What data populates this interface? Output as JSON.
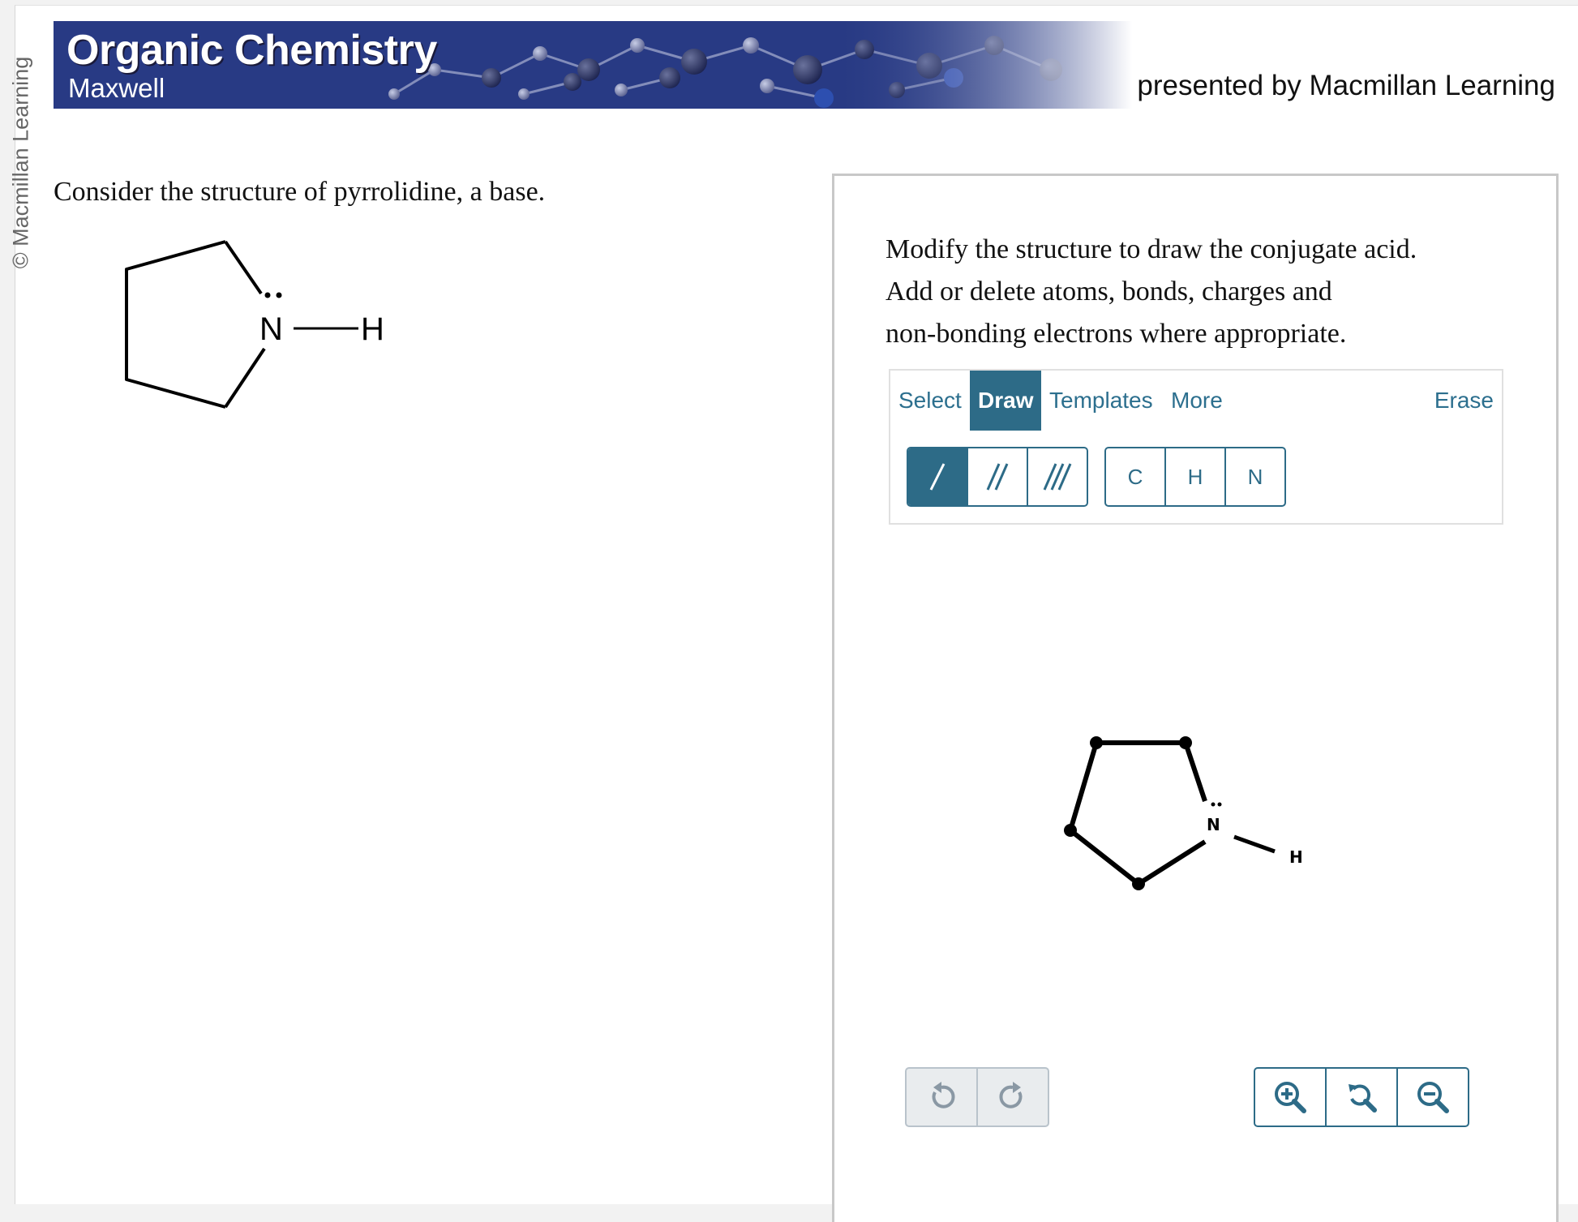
{
  "side_credit": "© Macmillan Learning",
  "banner": {
    "title": "Organic Chemistry",
    "subtitle": "Maxwell",
    "presented_by": "presented by Macmillan Learning"
  },
  "question": {
    "text": "Consider the structure of pyrrolidine, a base.",
    "molecule": {
      "n_label": "N",
      "h_label": "H",
      "lone_pair": ":"
    }
  },
  "panel": {
    "instructions": [
      "Modify the structure to draw the conjugate acid.",
      "Add or delete atoms, bonds, charges and",
      "non-bonding electrons where appropriate."
    ],
    "tabs": {
      "select": "Select",
      "draw": "Draw",
      "templates": "Templates",
      "more": "More",
      "erase": "Erase"
    },
    "active_tab": "Draw",
    "bond_tools": [
      "/",
      "//",
      "///"
    ],
    "selected_bond_tool": "/",
    "atom_tools": [
      "C",
      "H",
      "N"
    ],
    "canvas_molecule": {
      "n_label": "N",
      "h_label": "H",
      "lone_pair": ":"
    },
    "history_buttons": [
      "undo-icon",
      "redo-icon"
    ],
    "zoom_buttons": [
      "zoom-in-icon",
      "zoom-reset-icon",
      "zoom-out-icon"
    ]
  },
  "colors": {
    "accent": "#2d6b87",
    "banner": "#283a84",
    "panel_border": "#c8c8c8"
  }
}
